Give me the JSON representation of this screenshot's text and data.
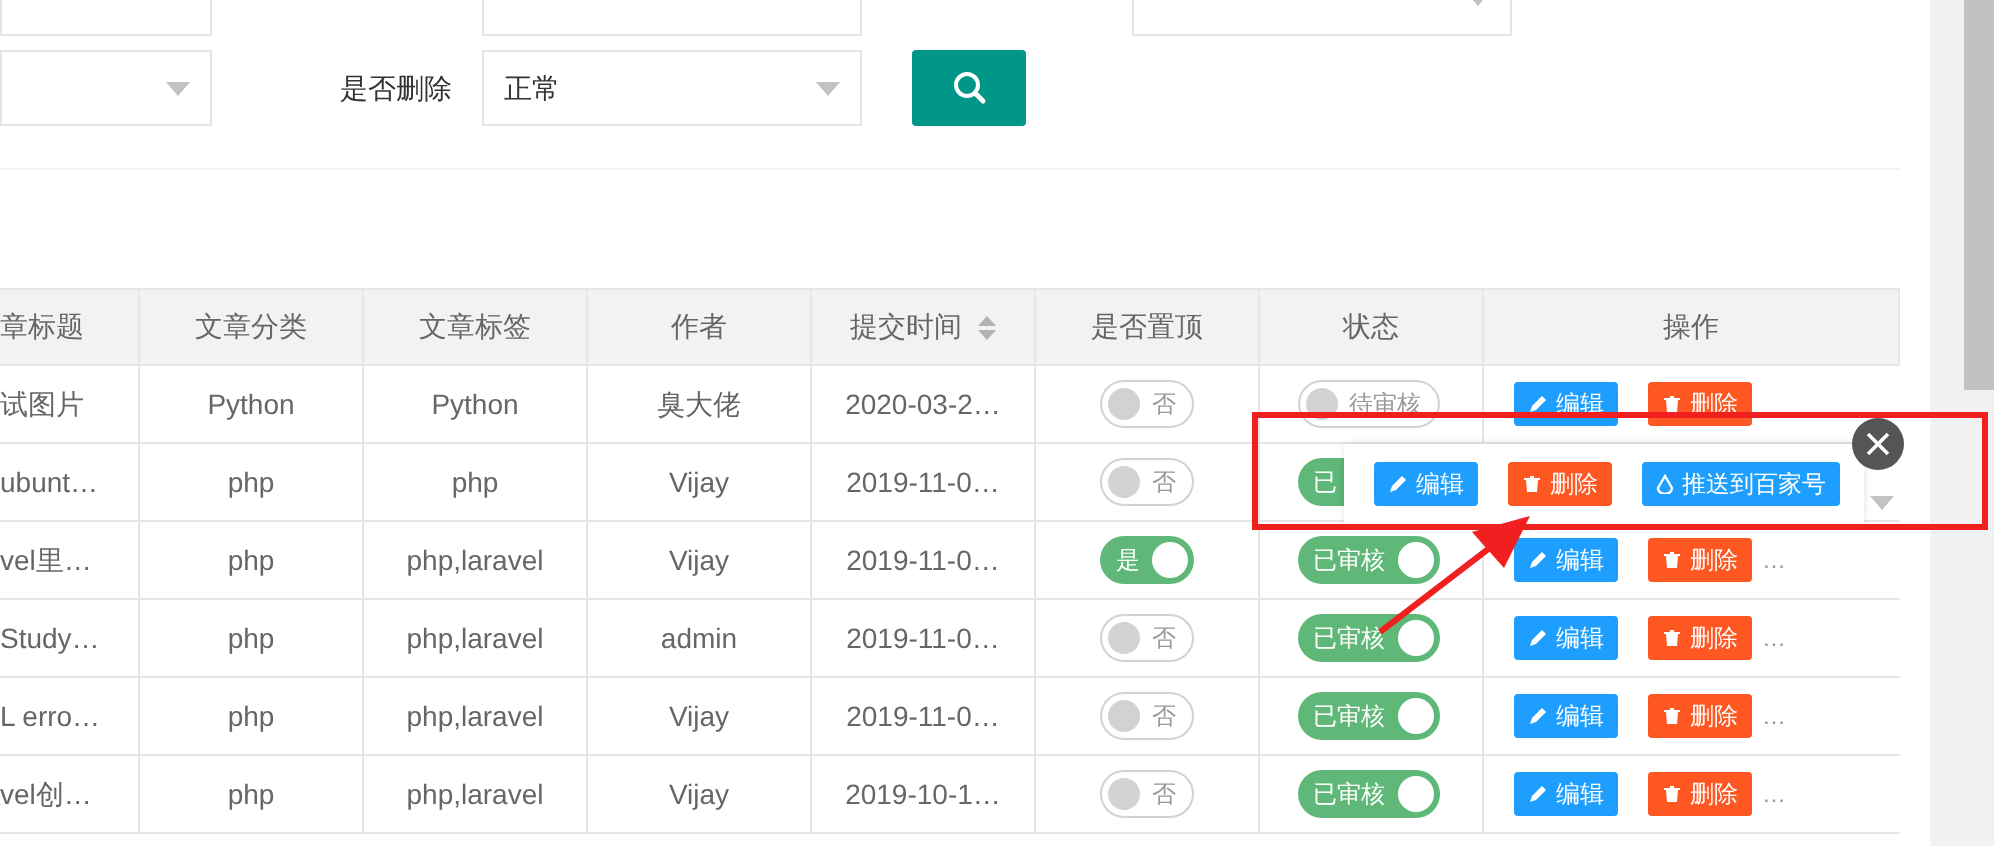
{
  "filters": [
    [
      {
        "kind": "input"
      },
      {
        "kind": "input"
      },
      {
        "kind": "select"
      }
    ],
    [
      {
        "kind": "select"
      },
      {
        "kind": "select",
        "label": "是否删除",
        "value": "正常"
      }
    ]
  ],
  "table": {
    "columns": [
      {
        "label": "章标题",
        "sortable": false
      },
      {
        "label": "文章分类",
        "sortable": false
      },
      {
        "label": "文章标签",
        "sortable": false
      },
      {
        "label": "作者",
        "sortable": false
      },
      {
        "label": "提交时间",
        "sortable": true
      },
      {
        "label": "是否置顶",
        "sortable": false
      },
      {
        "label": "状态",
        "sortable": false
      },
      {
        "label": "操作",
        "sortable": false
      }
    ],
    "rows": [
      {
        "title": "试图片",
        "category": "Python",
        "tags": "Python",
        "author": "臭大佬",
        "time": "2020-03-2…",
        "pinned": {
          "label": "否",
          "on": false
        },
        "status": {
          "label": "待审核",
          "on": false
        },
        "actions": [
          {
            "kind": "edit",
            "label": "编辑"
          },
          {
            "kind": "delete",
            "label": "删除"
          }
        ]
      },
      {
        "title": "ubunt…",
        "category": "php",
        "tags": "php",
        "author": "Vijay",
        "time": "2019-11-0…",
        "pinned": {
          "label": "否",
          "on": false
        },
        "status": {
          "label": "已",
          "on": true
        }
      },
      {
        "title": "vel里…",
        "category": "php",
        "tags": "php,laravel",
        "author": "Vijay",
        "time": "2019-11-0…",
        "pinned": {
          "label": "是",
          "on": true
        },
        "status": {
          "label": "已审核",
          "on": true
        },
        "actions": [
          {
            "kind": "edit",
            "label": "编辑"
          },
          {
            "kind": "delete",
            "label": "删除"
          }
        ],
        "more": "…"
      },
      {
        "title": "Study…",
        "category": "php",
        "tags": "php,laravel",
        "author": "admin",
        "time": "2019-11-0…",
        "pinned": {
          "label": "否",
          "on": false
        },
        "status": {
          "label": "已审核",
          "on": true
        },
        "actions": [
          {
            "kind": "edit",
            "label": "编辑"
          },
          {
            "kind": "delete",
            "label": "删除"
          }
        ],
        "more": "…"
      },
      {
        "title": "L erro…",
        "category": "php",
        "tags": "php,laravel",
        "author": "Vijay",
        "time": "2019-11-0…",
        "pinned": {
          "label": "否",
          "on": false
        },
        "status": {
          "label": "已审核",
          "on": true
        },
        "actions": [
          {
            "kind": "edit",
            "label": "编辑"
          },
          {
            "kind": "delete",
            "label": "删除"
          }
        ],
        "more": "…"
      },
      {
        "title": "vel创…",
        "category": "php",
        "tags": "php,laravel",
        "author": "Vijay",
        "time": "2019-10-1…",
        "pinned": {
          "label": "否",
          "on": false
        },
        "status": {
          "label": "已审核",
          "on": true
        },
        "actions": [
          {
            "kind": "edit",
            "label": "编辑"
          },
          {
            "kind": "delete",
            "label": "删除"
          }
        ],
        "more": "…"
      }
    ]
  },
  "popup": {
    "actions": [
      {
        "kind": "edit",
        "label": "编辑"
      },
      {
        "kind": "delete",
        "label": "删除"
      },
      {
        "kind": "push",
        "label": "推送到百家号"
      }
    ]
  }
}
